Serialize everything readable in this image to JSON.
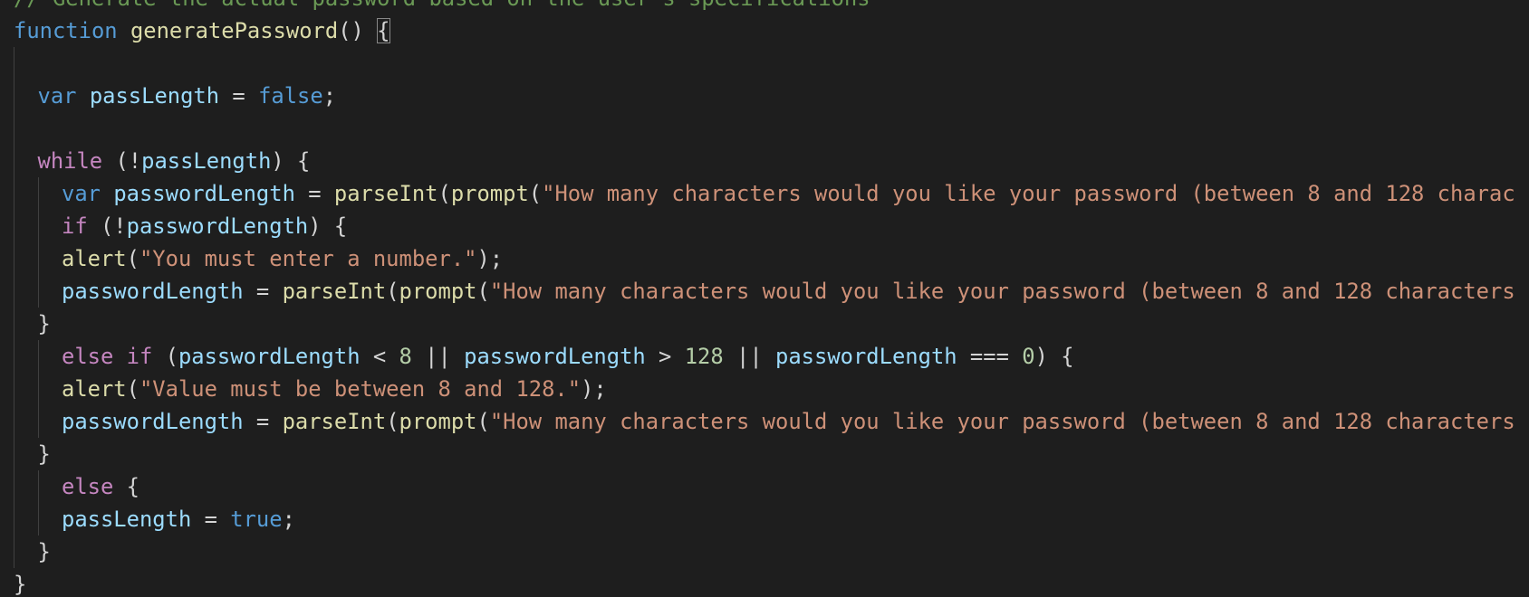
{
  "editor": {
    "language": "javascript",
    "theme": "dark",
    "colors": {
      "background": "#1e1e1e",
      "comment": "#6a9955",
      "keyword": "#569cd6",
      "control": "#c586c0",
      "function": "#dcdcaa",
      "variable": "#9cdcfe",
      "string": "#ce9178",
      "number": "#b5cea8",
      "punctuation": "#d4d4d4"
    },
    "lines": [
      {
        "indent": 0,
        "guides": 0,
        "tokens": [
          {
            "text": "// Generate the actual password based on the user's specifications",
            "kind": "comment"
          }
        ]
      },
      {
        "indent": 0,
        "guides": 0,
        "tokens": [
          {
            "text": "function",
            "kind": "keyword"
          },
          {
            "text": " ",
            "kind": "punctuation"
          },
          {
            "text": "generatePassword",
            "kind": "function"
          },
          {
            "text": "() ",
            "kind": "punctuation"
          },
          {
            "text": "{",
            "kind": "punctuation",
            "highlight": true
          }
        ]
      },
      {
        "indent": 0,
        "guides": 1,
        "tokens": []
      },
      {
        "indent": 1,
        "guides": 0,
        "tokens": [
          {
            "text": "var",
            "kind": "keyword"
          },
          {
            "text": " ",
            "kind": "punctuation"
          },
          {
            "text": "passLength",
            "kind": "variable"
          },
          {
            "text": " = ",
            "kind": "punctuation"
          },
          {
            "text": "false",
            "kind": "keyword"
          },
          {
            "text": ";",
            "kind": "punctuation"
          }
        ]
      },
      {
        "indent": 0,
        "guides": 1,
        "tokens": []
      },
      {
        "indent": 1,
        "guides": 0,
        "tokens": [
          {
            "text": "while",
            "kind": "control"
          },
          {
            "text": " (!",
            "kind": "punctuation"
          },
          {
            "text": "passLength",
            "kind": "variable"
          },
          {
            "text": ") {",
            "kind": "punctuation"
          }
        ]
      },
      {
        "indent": 2,
        "guides": 1,
        "tokens": [
          {
            "text": "var",
            "kind": "keyword"
          },
          {
            "text": " ",
            "kind": "punctuation"
          },
          {
            "text": "passwordLength",
            "kind": "variable"
          },
          {
            "text": " = ",
            "kind": "punctuation"
          },
          {
            "text": "parseInt",
            "kind": "function"
          },
          {
            "text": "(",
            "kind": "punctuation"
          },
          {
            "text": "prompt",
            "kind": "function"
          },
          {
            "text": "(",
            "kind": "punctuation"
          },
          {
            "text": "\"How many characters would you like your password (between 8 and 128 charac",
            "kind": "string"
          }
        ]
      },
      {
        "indent": 2,
        "guides": 1,
        "tokens": [
          {
            "text": "if",
            "kind": "control"
          },
          {
            "text": " (!",
            "kind": "punctuation"
          },
          {
            "text": "passwordLength",
            "kind": "variable"
          },
          {
            "text": ") {",
            "kind": "punctuation"
          }
        ]
      },
      {
        "indent": 2,
        "guides": 1,
        "tokens": [
          {
            "text": "alert",
            "kind": "function"
          },
          {
            "text": "(",
            "kind": "punctuation"
          },
          {
            "text": "\"You must enter a number.\"",
            "kind": "string"
          },
          {
            "text": ");",
            "kind": "punctuation"
          }
        ]
      },
      {
        "indent": 2,
        "guides": 1,
        "tokens": [
          {
            "text": "passwordLength",
            "kind": "variable"
          },
          {
            "text": " = ",
            "kind": "punctuation"
          },
          {
            "text": "parseInt",
            "kind": "function"
          },
          {
            "text": "(",
            "kind": "punctuation"
          },
          {
            "text": "prompt",
            "kind": "function"
          },
          {
            "text": "(",
            "kind": "punctuation"
          },
          {
            "text": "\"How many characters would you like your password (between 8 and 128 characters",
            "kind": "string"
          }
        ]
      },
      {
        "indent": 1,
        "guides": 0,
        "tokens": [
          {
            "text": "}",
            "kind": "punctuation"
          }
        ]
      },
      {
        "indent": 2,
        "guides": 1,
        "tokens": [
          {
            "text": "else",
            "kind": "control"
          },
          {
            "text": " ",
            "kind": "punctuation"
          },
          {
            "text": "if",
            "kind": "control"
          },
          {
            "text": " (",
            "kind": "punctuation"
          },
          {
            "text": "passwordLength",
            "kind": "variable"
          },
          {
            "text": " < ",
            "kind": "punctuation"
          },
          {
            "text": "8",
            "kind": "number"
          },
          {
            "text": " || ",
            "kind": "punctuation"
          },
          {
            "text": "passwordLength",
            "kind": "variable"
          },
          {
            "text": " > ",
            "kind": "punctuation"
          },
          {
            "text": "128",
            "kind": "number"
          },
          {
            "text": " || ",
            "kind": "punctuation"
          },
          {
            "text": "passwordLength",
            "kind": "variable"
          },
          {
            "text": " === ",
            "kind": "punctuation"
          },
          {
            "text": "0",
            "kind": "number"
          },
          {
            "text": ") {",
            "kind": "punctuation"
          }
        ]
      },
      {
        "indent": 2,
        "guides": 1,
        "tokens": [
          {
            "text": "alert",
            "kind": "function"
          },
          {
            "text": "(",
            "kind": "punctuation"
          },
          {
            "text": "\"Value must be between 8 and 128.\"",
            "kind": "string"
          },
          {
            "text": ");",
            "kind": "punctuation"
          }
        ]
      },
      {
        "indent": 2,
        "guides": 1,
        "tokens": [
          {
            "text": "passwordLength",
            "kind": "variable"
          },
          {
            "text": " = ",
            "kind": "punctuation"
          },
          {
            "text": "parseInt",
            "kind": "function"
          },
          {
            "text": "(",
            "kind": "punctuation"
          },
          {
            "text": "prompt",
            "kind": "function"
          },
          {
            "text": "(",
            "kind": "punctuation"
          },
          {
            "text": "\"How many characters would you like your password (between 8 and 128 characters",
            "kind": "string"
          }
        ]
      },
      {
        "indent": 1,
        "guides": 0,
        "tokens": [
          {
            "text": "}",
            "kind": "punctuation"
          }
        ]
      },
      {
        "indent": 2,
        "guides": 1,
        "tokens": [
          {
            "text": "else",
            "kind": "control"
          },
          {
            "text": " {",
            "kind": "punctuation"
          }
        ]
      },
      {
        "indent": 2,
        "guides": 1,
        "tokens": [
          {
            "text": "passLength",
            "kind": "variable"
          },
          {
            "text": " = ",
            "kind": "punctuation"
          },
          {
            "text": "true",
            "kind": "keyword"
          },
          {
            "text": ";",
            "kind": "punctuation"
          }
        ]
      },
      {
        "indent": 1,
        "guides": 1,
        "tokens": [
          {
            "text": "}",
            "kind": "punctuation"
          }
        ]
      },
      {
        "indent": 0,
        "guides": 0,
        "tokens": [
          {
            "text": "}",
            "kind": "punctuation"
          }
        ]
      }
    ]
  }
}
